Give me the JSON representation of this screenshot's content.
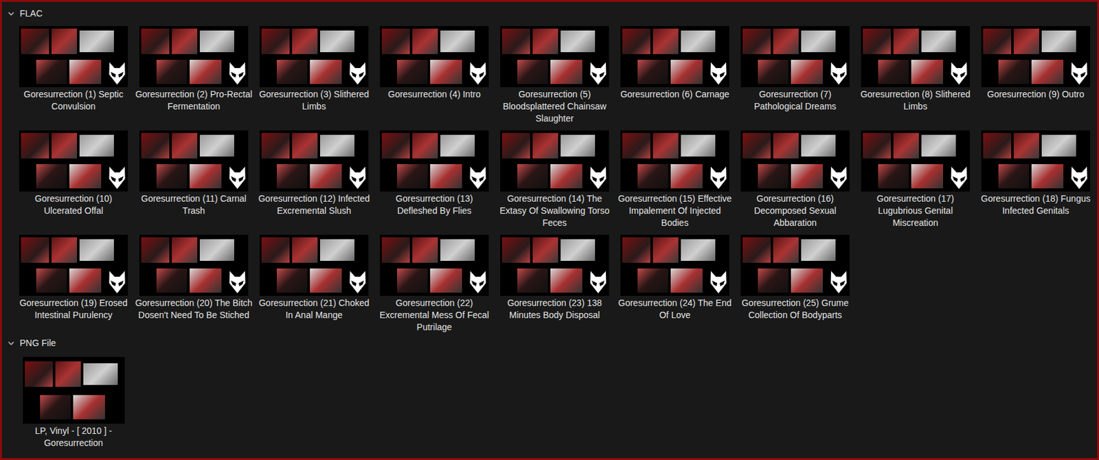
{
  "groups": [
    {
      "name": "FLAC",
      "expanded": true,
      "items": [
        {
          "label": "Goresurrection (1) Septic Convulsion",
          "kind": "flac"
        },
        {
          "label": "Goresurrection (2) Pro-Rectal Fermentation",
          "kind": "flac"
        },
        {
          "label": "Goresurrection (3) Slithered Limbs",
          "kind": "flac"
        },
        {
          "label": "Goresurrection (4) Intro",
          "kind": "flac"
        },
        {
          "label": "Goresurrection (5) Bloodsplattered Chainsaw Slaughter",
          "kind": "flac"
        },
        {
          "label": "Goresurrection (6) Carnage",
          "kind": "flac"
        },
        {
          "label": "Goresurrection (7) Pathological Dreams",
          "kind": "flac"
        },
        {
          "label": "Goresurrection (8) Slithered Limbs",
          "kind": "flac"
        },
        {
          "label": "Goresurrection (9) Outro",
          "kind": "flac"
        },
        {
          "label": "Goresurrection (10) Ulcerated Offal",
          "kind": "flac"
        },
        {
          "label": "Goresurrection (11) Carnal Trash",
          "kind": "flac"
        },
        {
          "label": "Goresurrection (12) Infected Excremental Slush",
          "kind": "flac"
        },
        {
          "label": "Goresurrection (13) Defleshed By Flies",
          "kind": "flac"
        },
        {
          "label": "Goresurrection (14) The Extasy Of Swallowing Torso Feces",
          "kind": "flac"
        },
        {
          "label": "Goresurrection (15) Effective Impalement Of Injected Bodies",
          "kind": "flac"
        },
        {
          "label": "Goresurrection (16) Decomposed Sexual Abbaration",
          "kind": "flac"
        },
        {
          "label": "Goresurrection (17) Lugubrious Genital Miscreation",
          "kind": "flac"
        },
        {
          "label": "Goresurrection (18) Fungus Infected Genitals",
          "kind": "flac"
        },
        {
          "label": "Goresurrection (19) Erosed Intestinal Purulency",
          "kind": "flac"
        },
        {
          "label": "Goresurrection (20) The Bitch Dosen't Need To Be Stiched",
          "kind": "flac"
        },
        {
          "label": "Goresurrection (21) Choked In Anal Mange",
          "kind": "flac"
        },
        {
          "label": "Goresurrection (22) Excremental Mess Of Fecal Putrilage",
          "kind": "flac"
        },
        {
          "label": "Goresurrection (23) 138 Minutes Body Disposal",
          "kind": "flac"
        },
        {
          "label": "Goresurrection (24) The End Of Love",
          "kind": "flac"
        },
        {
          "label": "Goresurrection (25) Grume Collection Of Bodyparts",
          "kind": "flac"
        }
      ]
    },
    {
      "name": "PNG File",
      "expanded": true,
      "items": [
        {
          "label": "LP, Vinyl - [ 2010 ] - Goresurrection",
          "kind": "png"
        }
      ]
    }
  ]
}
